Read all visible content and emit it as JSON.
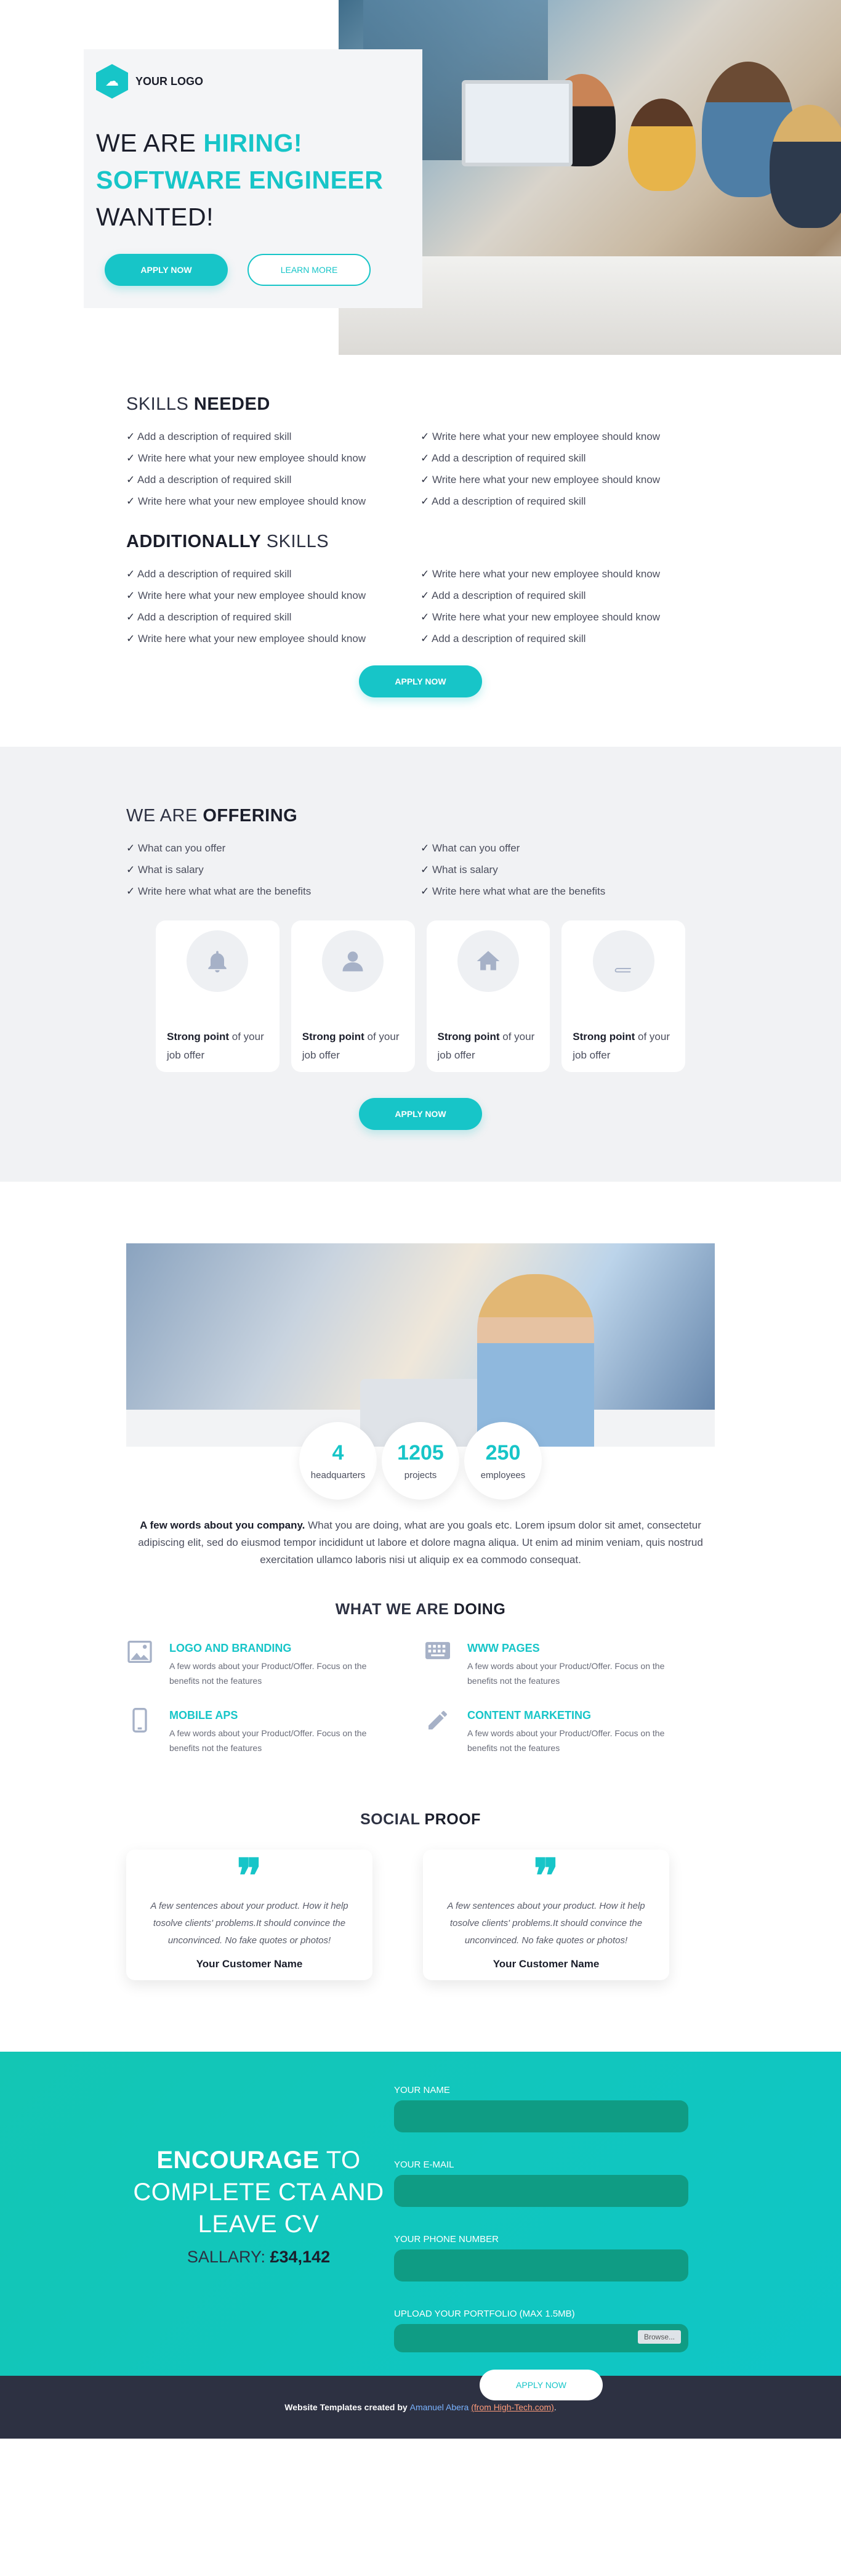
{
  "hero": {
    "logo_text": "YOUR LOGO",
    "title_line1_plain": "WE ARE ",
    "title_line1_accent": "HIRING!",
    "title_line2": "SOFTWARE ENGINEER",
    "title_line3": "WANTED!",
    "apply_label": "APPLY NOW",
    "learn_label": "LEARN MORE"
  },
  "skills": {
    "title_plain": "SKILLS ",
    "title_bold": "NEEDED",
    "left": [
      "Add a description of required skill",
      "Write here what your new employee should know",
      "Add a description of required skill",
      "Write here what your new employee should know"
    ],
    "right": [
      "Write here what your new employee should know",
      "Add a description of required skill",
      "Write here what your new employee should know",
      "Add a description of required skill"
    ],
    "add_title_bold": "ADDITIONALLY",
    "add_title_plain": " SKILLS",
    "add_left": [
      "Add a description of required skill",
      "Write here what your new employee should know",
      "Add a description of required skill",
      "Write here what your new employee should know"
    ],
    "add_right": [
      "Write here what your new employee should know",
      "Add a description of required skill",
      "Write here what your new employee should know",
      "Add a description of required skill"
    ],
    "apply_label": "APPLY NOW"
  },
  "offering": {
    "title_plain": "WE ARE ",
    "title_bold": "OFFERING",
    "left": [
      "What can you offer",
      "What is salary",
      "Write here what what are the benefits"
    ],
    "right": [
      "What can you offer",
      "What is salary",
      "Write here what what are the benefits"
    ],
    "cards": [
      {
        "icon": "bell-icon",
        "bold": "Strong point",
        "text": " of your job offer"
      },
      {
        "icon": "user-icon",
        "bold": "Strong point",
        "text": " of your job offer"
      },
      {
        "icon": "home-icon",
        "bold": "Strong point",
        "text": " of your job offer"
      },
      {
        "icon": "book-icon",
        "bold": "Strong point",
        "text": " of your job offer"
      }
    ],
    "apply_label": "APPLY NOW"
  },
  "about": {
    "stats": [
      {
        "num": "4",
        "label": "headquarters"
      },
      {
        "num": "1205",
        "label": "projects"
      },
      {
        "num": "250",
        "label": "employees"
      }
    ],
    "text_bold": "A few words about you company.",
    "text": " What you are doing, what are you goals etc. Lorem ipsum dolor sit amet, consectetur adipiscing elit, sed do eiusmod tempor incididunt ut labore et dolore magna aliqua. Ut enim ad minim veniam, quis nostrud exercitation ullamco laboris nisi ut aliquip ex ea commodo consequat.",
    "doing_plain": "WHAT WE ARE ",
    "doing_bold": "DOING",
    "services": [
      {
        "icon": "image-icon",
        "title": "LOGO AND BRANDING",
        "desc": "A few words about your Product/Offer. Focus on the benefits not the features"
      },
      {
        "icon": "keyboard-icon",
        "title": "WWW PAGES",
        "desc": "A few words about your Product/Offer. Focus on the benefits not the features"
      },
      {
        "icon": "phone-icon",
        "title": "MOBILE APS",
        "desc": "A few words about your Product/Offer. Focus on the benefits not the features"
      },
      {
        "icon": "pencil-icon",
        "title": "CONTENT MARKETING",
        "desc": "A few words about your Product/Offer. Focus on the benefits not the features"
      }
    ]
  },
  "proof": {
    "title_plain": "SOCIAL ",
    "title_bold": "PROOF",
    "quotes": [
      {
        "text": "A few sentences about your product. How it help tosolve clients' problems.It should convince the unconvinced. No fake quotes or photos!",
        "name": "Your Customer Name"
      },
      {
        "text": "A few sentences about your product. How it help tosolve clients' problems.It should convince the unconvinced. No fake quotes or photos!",
        "name": "Your Customer Name"
      }
    ]
  },
  "cta": {
    "title_bold": "ENCOURAGE",
    "title_rest": " TO COMPLETE CTA AND LEAVE CV",
    "salary_label": "SALLARY: ",
    "salary_value": "£34,142",
    "name_label": "YOUR NAME",
    "email_label": "YOUR E-MAIL",
    "phone_label": "YOUR PHONE NUMBER",
    "upload_label": "UPLOAD YOUR PORTFOLIO (MAX 1.5MB)",
    "browse_label": "Browse...",
    "apply_label": "APPLY NOW"
  },
  "footer": {
    "prefix": "Website Templates created by ",
    "author": "Amanuel Abera",
    "source": "(from High-Tech.com)",
    "suffix": "."
  },
  "colors": {
    "accent": "#17c5c8",
    "dark": "#2d3142",
    "cta_bg": "#13c6b4"
  }
}
